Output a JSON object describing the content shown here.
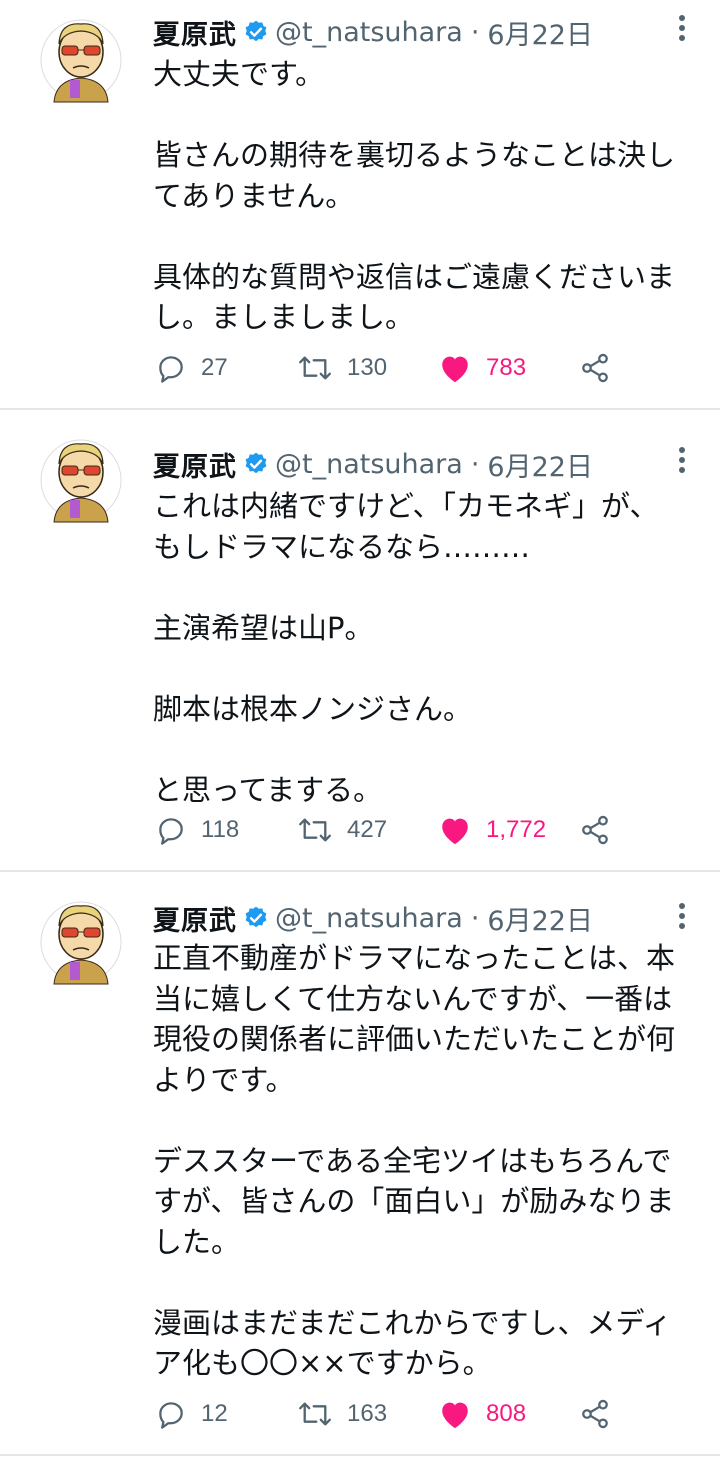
{
  "tweets": [
    {
      "author": {
        "name": "夏原武",
        "handle": "@t_natsuhara",
        "separator": "·",
        "date": "6月22日"
      },
      "lines": [
        "大丈夫です。",
        "",
        "皆さんの期待を裏切るようなことは決し",
        "てありません。",
        "",
        "具体的な質問や返信はご遠慮くださいま",
        "し。ましましまし。"
      ],
      "stats": {
        "replies": "27",
        "retweets": "130",
        "likes": "783"
      }
    },
    {
      "author": {
        "name": "夏原武",
        "handle": "@t_natsuhara",
        "separator": "·",
        "date": "6月22日"
      },
      "lines": [
        "これは内緒ですけど、「カモネギ」が、",
        "もしドラマになるなら………",
        "",
        "主演希望は山P。",
        "",
        "脚本は根本ノンジさん。",
        "",
        "と思ってまする。"
      ],
      "stats": {
        "replies": "118",
        "retweets": "427",
        "likes": "1,772"
      }
    },
    {
      "author": {
        "name": "夏原武",
        "handle": "@t_natsuhara",
        "separator": "·",
        "date": "6月22日"
      },
      "lines": [
        "正直不動産がドラマになったことは、本",
        "当に嬉しくて仕方ないんですが、一番は",
        "現役の関係者に評価いただいたことが何",
        "よりです。",
        "",
        "デススターである全宅ツイはもちろんで",
        "すが、皆さんの「面白い」が励みなりま",
        "した。",
        "",
        "漫画はまだまだこれからですし、メディ",
        "ア化も〇〇××ですから。"
      ],
      "stats": {
        "replies": "12",
        "retweets": "163",
        "likes": "808"
      }
    }
  ],
  "colors": {
    "text": "#0f1419",
    "secondary": "#536471",
    "like": "#f91880",
    "verified": "#1d9bf0",
    "divider": "#e6e6e6"
  },
  "icons": {
    "reply": "reply-icon",
    "retweet": "retweet-icon",
    "like": "heart-icon",
    "share": "share-icon",
    "more": "more-vertical-icon",
    "verified": "verified-badge-icon"
  }
}
